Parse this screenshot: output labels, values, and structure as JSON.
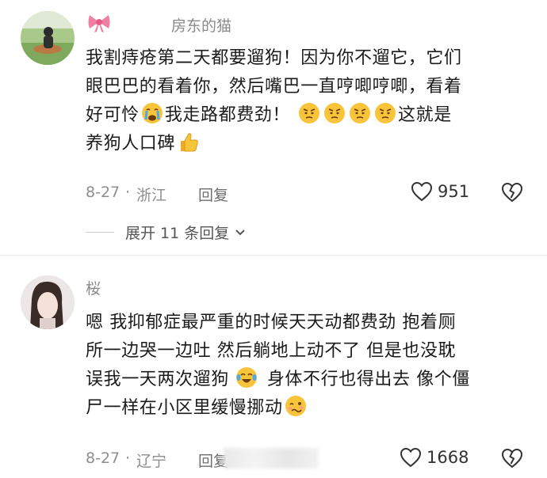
{
  "comments": [
    {
      "username": "房东的猫",
      "lines": [
        "我割痔疮第二天都要遛狗！因为你不遛它，它们",
        "眼巴巴的看着你，然后嘴巴一直哼唧哼唧，看着",
        "好可怜",
        "我走路都费劲！",
        "这就是",
        "养狗人口碑"
      ],
      "date": "8-27",
      "location": "浙江",
      "reply_label": "回复",
      "likes": "951",
      "expand_label": "展开 11 条回复"
    },
    {
      "username": "桜",
      "lines": [
        "嗯 我抑郁症最严重的时候天天动都费劲 抱着厕",
        "所一边哭一边吐 然后躺地上动不了 但是也没耽",
        "误我一天两次遛狗",
        "身体不行也得出去 像个僵",
        "尸一样在小区里缓慢挪动"
      ],
      "date": "8-27",
      "location": "辽宁",
      "reply_label": "回复",
      "likes": "1668"
    }
  ],
  "icons": {
    "bow": "pink-bow-icon",
    "crying": "crying-face-emoji",
    "annoyed": "annoyed-face-emoji",
    "thumbs": "thumbs-up-emoji",
    "joy": "tears-of-joy-emoji",
    "woozy": "woozy-face-emoji",
    "like": "heart-icon",
    "dislike": "broken-heart-icon",
    "chevron": "chevron-down-icon"
  },
  "colors": {
    "text": "#1b1b1b",
    "meta": "#8e8e8e",
    "bow": "#f07fa0",
    "emoji": "#f8c43a"
  }
}
